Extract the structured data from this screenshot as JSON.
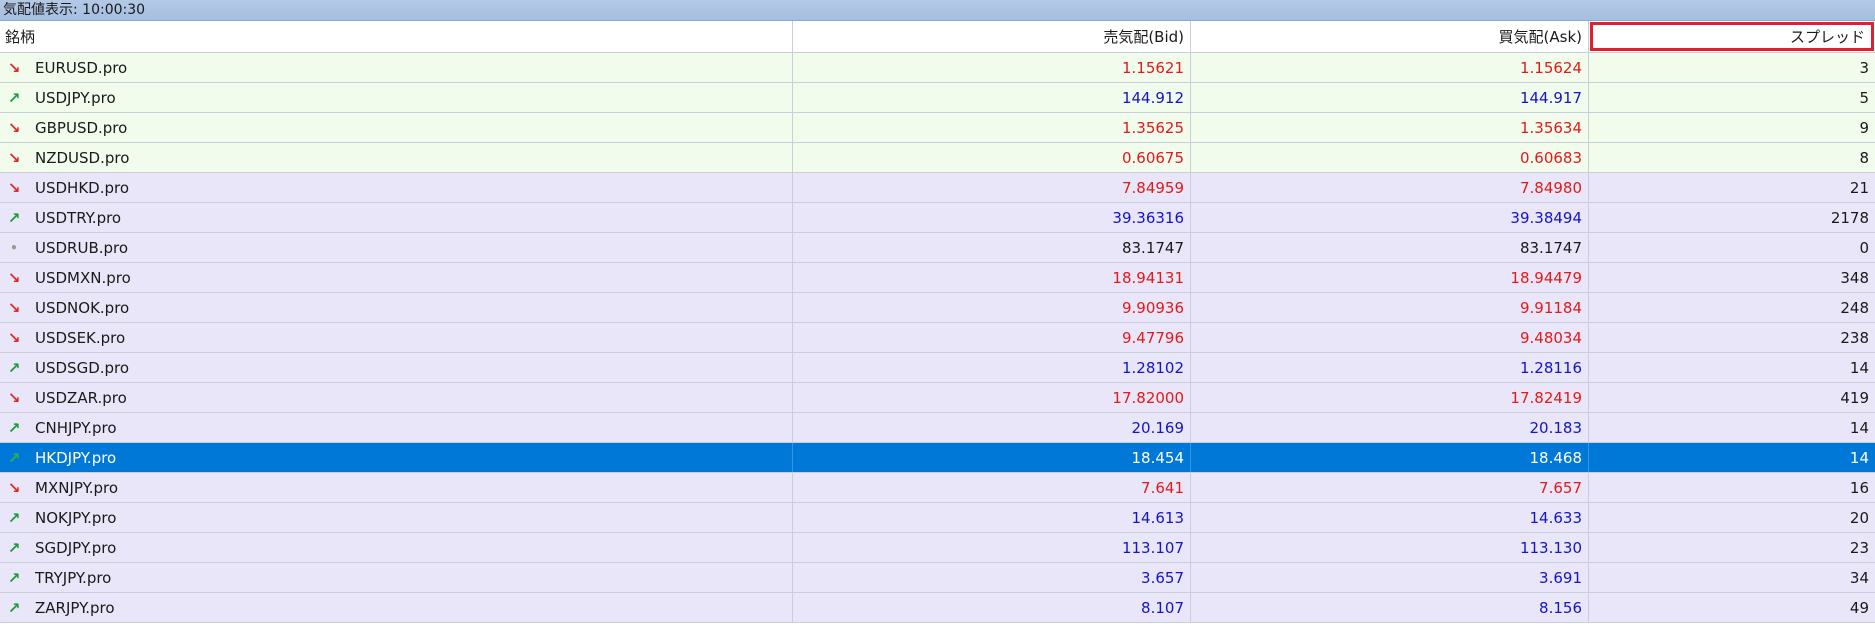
{
  "window": {
    "title": "気配値表示: 10:00:30"
  },
  "columns": {
    "symbol": "銘柄",
    "bid": "売気配(Bid)",
    "ask": "買気配(Ask)",
    "spread": "スプレッド"
  },
  "colors": {
    "up": "#1414c8",
    "down": "#e41919",
    "selected_bg": "#0078d7",
    "highlight_border": "#e0202c"
  },
  "rows": [
    {
      "symbol": "EURUSD.pro",
      "dir": "down",
      "bid": "1.15621",
      "ask": "1.15624",
      "spread": "3",
      "group": "green"
    },
    {
      "symbol": "USDJPY.pro",
      "dir": "up",
      "bid": "144.912",
      "ask": "144.917",
      "spread": "5",
      "group": "green"
    },
    {
      "symbol": "GBPUSD.pro",
      "dir": "down",
      "bid": "1.35625",
      "ask": "1.35634",
      "spread": "9",
      "group": "green"
    },
    {
      "symbol": "NZDUSD.pro",
      "dir": "down",
      "bid": "0.60675",
      "ask": "0.60683",
      "spread": "8",
      "group": "green"
    },
    {
      "symbol": "USDHKD.pro",
      "dir": "down",
      "bid": "7.84959",
      "ask": "7.84980",
      "spread": "21",
      "group": "lav"
    },
    {
      "symbol": "USDTRY.pro",
      "dir": "up",
      "bid": "39.36316",
      "ask": "39.38494",
      "spread": "2178",
      "group": "lav"
    },
    {
      "symbol": "USDRUB.pro",
      "dir": "flat",
      "bid": "83.1747",
      "ask": "83.1747",
      "spread": "0",
      "group": "lav"
    },
    {
      "symbol": "USDMXN.pro",
      "dir": "down",
      "bid": "18.94131",
      "ask": "18.94479",
      "spread": "348",
      "group": "lav"
    },
    {
      "symbol": "USDNOK.pro",
      "dir": "down",
      "bid": "9.90936",
      "ask": "9.91184",
      "spread": "248",
      "group": "lav"
    },
    {
      "symbol": "USDSEK.pro",
      "dir": "down",
      "bid": "9.47796",
      "ask": "9.48034",
      "spread": "238",
      "group": "lav"
    },
    {
      "symbol": "USDSGD.pro",
      "dir": "up",
      "bid": "1.28102",
      "ask": "1.28116",
      "spread": "14",
      "group": "lav"
    },
    {
      "symbol": "USDZAR.pro",
      "dir": "down",
      "bid": "17.82000",
      "ask": "17.82419",
      "spread": "419",
      "group": "lav"
    },
    {
      "symbol": "CNHJPY.pro",
      "dir": "up",
      "bid": "20.169",
      "ask": "20.183",
      "spread": "14",
      "group": "lav"
    },
    {
      "symbol": "HKDJPY.pro",
      "dir": "up",
      "bid": "18.454",
      "ask": "18.468",
      "spread": "14",
      "group": "lav",
      "selected": true
    },
    {
      "symbol": "MXNJPY.pro",
      "dir": "down",
      "bid": "7.641",
      "ask": "7.657",
      "spread": "16",
      "group": "lav"
    },
    {
      "symbol": "NOKJPY.pro",
      "dir": "up",
      "bid": "14.613",
      "ask": "14.633",
      "spread": "20",
      "group": "lav"
    },
    {
      "symbol": "SGDJPY.pro",
      "dir": "up",
      "bid": "113.107",
      "ask": "113.130",
      "spread": "23",
      "group": "lav"
    },
    {
      "symbol": "TRYJPY.pro",
      "dir": "up",
      "bid": "3.657",
      "ask": "3.691",
      "spread": "34",
      "group": "lav"
    },
    {
      "symbol": "ZARJPY.pro",
      "dir": "up",
      "bid": "8.107",
      "ask": "8.156",
      "spread": "49",
      "group": "lav"
    }
  ]
}
